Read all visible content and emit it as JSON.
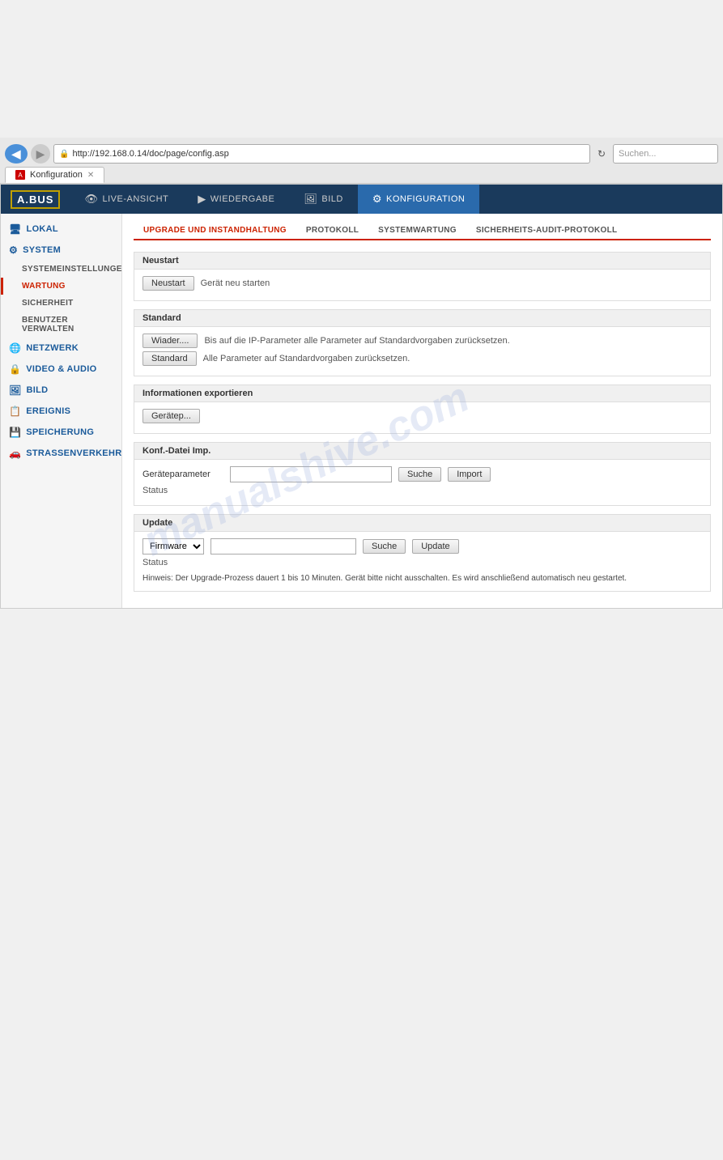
{
  "browser": {
    "address_url": "http://192.168.0.14/doc/page/config.asp",
    "search_placeholder": "Suchen...",
    "tab_label": "Konfiguration",
    "back_arrow": "◀",
    "forward_arrow": "▶",
    "refresh_icon": "↻"
  },
  "topnav": {
    "logo": "A.BUS",
    "items": [
      {
        "id": "live",
        "label": "LIVE-ANSICHT",
        "icon": "👁"
      },
      {
        "id": "playback",
        "label": "WIEDERGABE",
        "icon": "▶"
      },
      {
        "id": "image",
        "label": "BILD",
        "icon": "🖼"
      },
      {
        "id": "config",
        "label": "KONFIGURATION",
        "icon": "⚙",
        "active": true
      }
    ]
  },
  "sidebar": {
    "items": [
      {
        "id": "lokal",
        "label": "LOKAL",
        "icon": "🖥",
        "type": "main"
      },
      {
        "id": "system",
        "label": "SYSTEM",
        "icon": "⚙",
        "type": "main"
      },
      {
        "id": "systemeinstellungen",
        "label": "SYSTEMEINSTELLUNGEN",
        "type": "sub"
      },
      {
        "id": "wartung",
        "label": "WARTUNG",
        "type": "sub",
        "active": true
      },
      {
        "id": "sicherheit",
        "label": "SICHERHEIT",
        "type": "sub"
      },
      {
        "id": "benutzer",
        "label": "BENUTZER VERWALTEN",
        "type": "sub"
      },
      {
        "id": "netzwerk",
        "label": "NETZWERK",
        "icon": "🌐",
        "type": "main"
      },
      {
        "id": "video-audio",
        "label": "VIDEO & AUDIO",
        "icon": "🔒",
        "type": "main"
      },
      {
        "id": "bild",
        "label": "BILD",
        "icon": "🖼",
        "type": "main"
      },
      {
        "id": "ereignis",
        "label": "EREIGNIS",
        "icon": "📋",
        "type": "main"
      },
      {
        "id": "speicherung",
        "label": "SPEICHERUNG",
        "icon": "💾",
        "type": "main"
      },
      {
        "id": "strassenverkehr",
        "label": "STRASSENVERKEHR",
        "icon": "🚗",
        "type": "main"
      }
    ]
  },
  "content": {
    "subtabs": [
      {
        "id": "upgrade",
        "label": "UPGRADE UND INSTANDHALTUNG",
        "active": true
      },
      {
        "id": "protokoll",
        "label": "PROTOKOLL"
      },
      {
        "id": "systemwartung",
        "label": "SYSTEMWARTUNG"
      },
      {
        "id": "sicherheits-audit",
        "label": "SICHERHEITS-AUDIT-PROTOKOLL"
      }
    ],
    "sections": {
      "neustart": {
        "header": "Neustart",
        "button_label": "Neustart",
        "description": "Gerät neu starten"
      },
      "standard": {
        "header": "Standard",
        "button1_label": "Wiader....",
        "button1_desc": "Bis auf die IP-Parameter alle Parameter auf Standardvorgaben zurücksetzen.",
        "button2_label": "Standard",
        "button2_desc": "Alle Parameter auf Standardvorgaben zurücksetzen."
      },
      "info_export": {
        "header": "Informationen exportieren",
        "button_label": "Gerätep..."
      },
      "conf_import": {
        "header": "Konf.-Datei Imp.",
        "field_label": "Geräteparameter",
        "button_suche": "Suche",
        "button_import": "Import",
        "status_label": "Status"
      },
      "update": {
        "header": "Update",
        "select_value": "Firmware",
        "select_options": [
          "Firmware"
        ],
        "button_suche": "Suche",
        "button_update": "Update",
        "status_label": "Status",
        "hint": "Hinweis: Der Upgrade-Prozess dauert 1 bis 10 Minuten. Gerät bitte nicht ausschalten. Es wird anschließend automatisch neu gestartet."
      }
    }
  },
  "watermark": "manualshive.com"
}
